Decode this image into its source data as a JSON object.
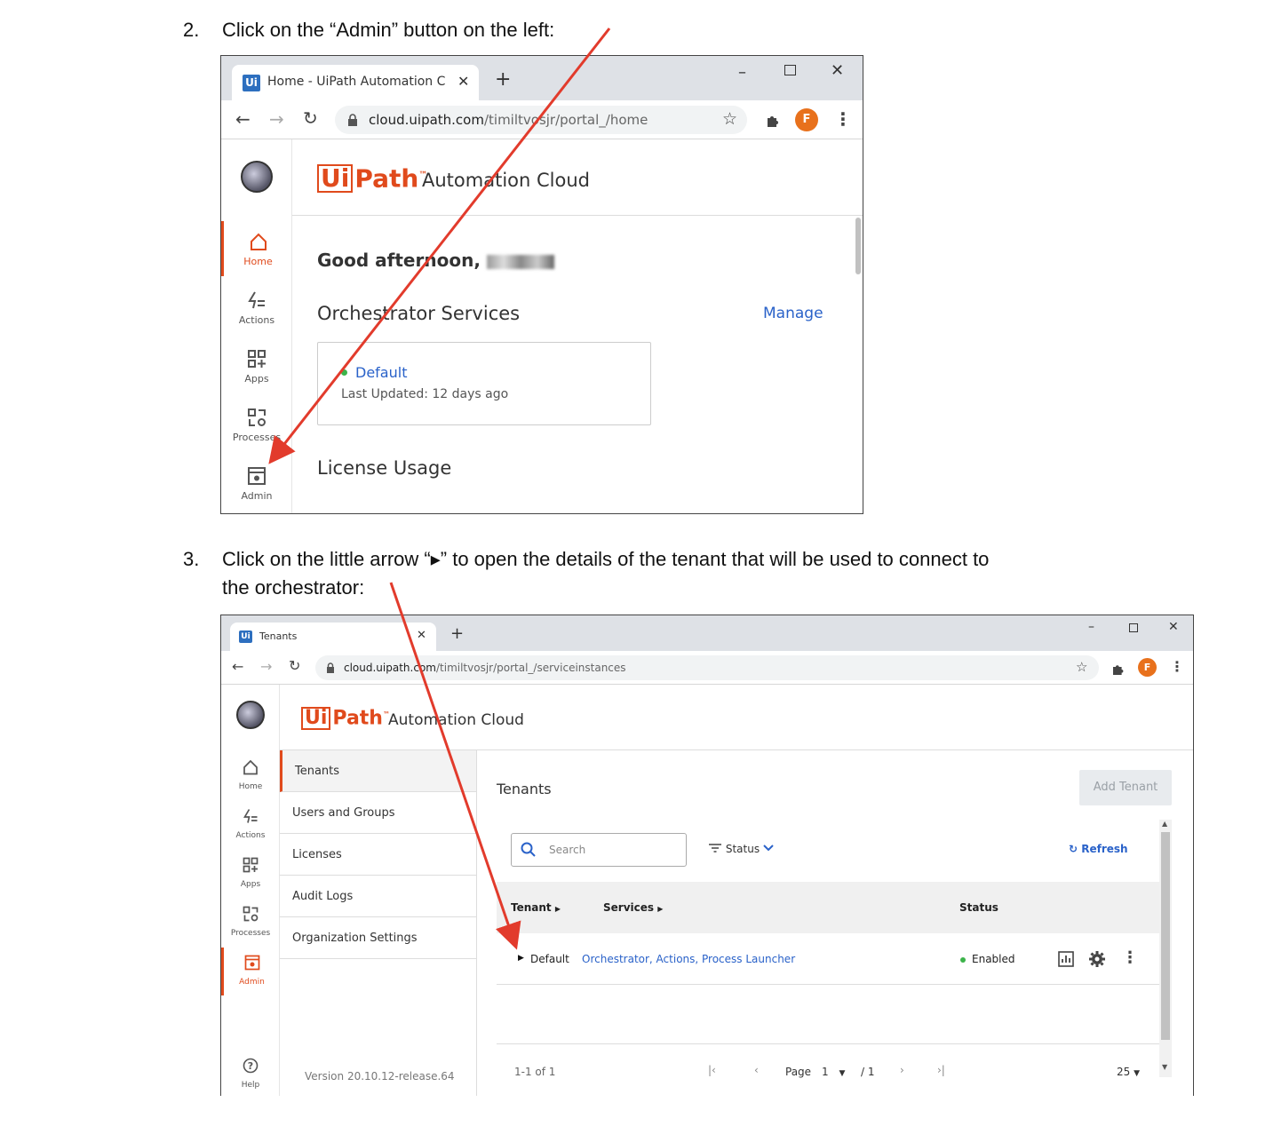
{
  "step2": {
    "num": "2.",
    "text": "Click on the “Admin” button on the left:"
  },
  "step3": {
    "num": "3.",
    "line1": "Click on the little arrow “▸” to open the details of the tenant that will be used to connect to",
    "line2": "the orchestrator:"
  },
  "browser1": {
    "tab_title": "Home - UiPath Automation Clou",
    "url_host": "cloud.uipath.com",
    "url_path": "/timiltvosjr/portal_/home",
    "profile_initial": "F",
    "logo_text": "Path",
    "logo_box": "Ui",
    "logo_tm": "™",
    "product": "Automation Cloud",
    "rail": [
      {
        "label": "Home",
        "icon": "home-icon"
      },
      {
        "label": "Actions",
        "icon": "actions-icon"
      },
      {
        "label": "Apps",
        "icon": "apps-icon"
      },
      {
        "label": "Processes",
        "icon": "processes-icon"
      },
      {
        "label": "Admin",
        "icon": "admin-icon"
      }
    ],
    "greeting": "Good afternoon,",
    "orch_title": "Orchestrator Services",
    "manage": "Manage",
    "card_name": "Default",
    "card_updated": "Last Updated: 12 days ago",
    "license_title": "License Usage"
  },
  "browser2": {
    "tab_title": "Tenants",
    "url_host": "cloud.uipath.com",
    "url_path": "/timiltvosjr/portal_/serviceinstances",
    "profile_initial": "F",
    "logo_text": "Path",
    "logo_box": "Ui",
    "logo_tm": "™",
    "product": "Automation Cloud",
    "rail": [
      {
        "label": "Home",
        "icon": "home-icon"
      },
      {
        "label": "Actions",
        "icon": "actions-icon"
      },
      {
        "label": "Apps",
        "icon": "apps-icon"
      },
      {
        "label": "Processes",
        "icon": "processes-icon"
      },
      {
        "label": "Admin",
        "icon": "admin-icon"
      }
    ],
    "help": "Help",
    "menu": [
      "Tenants",
      "Users and Groups",
      "Licenses",
      "Audit Logs",
      "Organization Settings"
    ],
    "version": "Version 20.10.12-release.64",
    "page_title": "Tenants",
    "add_tenant": "Add Tenant",
    "search_placeholder": "Search",
    "status_filter": "Status",
    "refresh": "Refresh",
    "columns": {
      "tenant": "Tenant",
      "services": "Services",
      "status": "Status"
    },
    "row": {
      "tenant": "Default",
      "services": "Orchestrator, Actions, Process Launcher",
      "status": "Enabled"
    },
    "footer": {
      "range": "1-1 of 1",
      "page_label": "Page",
      "page": "1",
      "of_pages": "/ 1",
      "page_size": "25"
    }
  },
  "colors": {
    "accent": "#e04a1c",
    "link": "#2a62c9",
    "arrow": "#e23b2c",
    "enabled": "#3cb34a"
  }
}
